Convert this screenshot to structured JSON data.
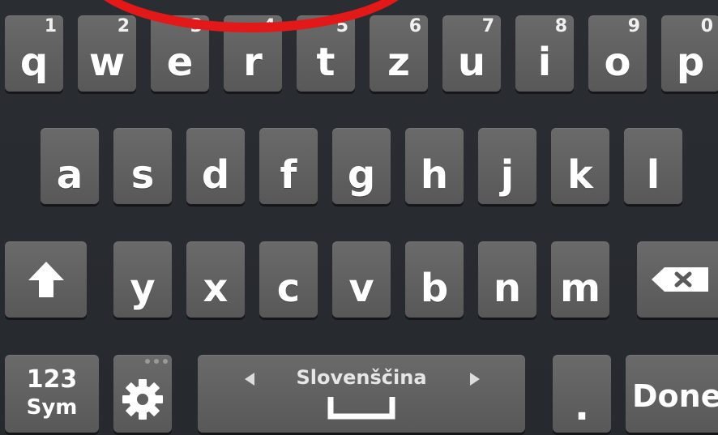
{
  "colors": {
    "key": "#5f5f5f",
    "background": "#282b30",
    "annotation": "#e31818"
  },
  "row1": [
    {
      "ch": "q",
      "hint": "1"
    },
    {
      "ch": "w",
      "hint": "2"
    },
    {
      "ch": "e",
      "hint": "3"
    },
    {
      "ch": "r",
      "hint": "4"
    },
    {
      "ch": "t",
      "hint": "5"
    },
    {
      "ch": "z",
      "hint": "6"
    },
    {
      "ch": "u",
      "hint": "7"
    },
    {
      "ch": "i",
      "hint": "8"
    },
    {
      "ch": "o",
      "hint": "9"
    },
    {
      "ch": "p",
      "hint": "0"
    }
  ],
  "row2": [
    "a",
    "s",
    "d",
    "f",
    "g",
    "h",
    "j",
    "k",
    "l"
  ],
  "row3": [
    "y",
    "x",
    "c",
    "v",
    "b",
    "n",
    "m"
  ],
  "bottom": {
    "sym_top": "123",
    "sym_bottom": "Sym",
    "language": "Slovenščina",
    "period": ".",
    "done": "Done"
  },
  "icons": {
    "shift": "shift-arrow-icon",
    "backspace": "backspace-icon",
    "settings": "gear-icon",
    "space": "space-bar-icon"
  }
}
